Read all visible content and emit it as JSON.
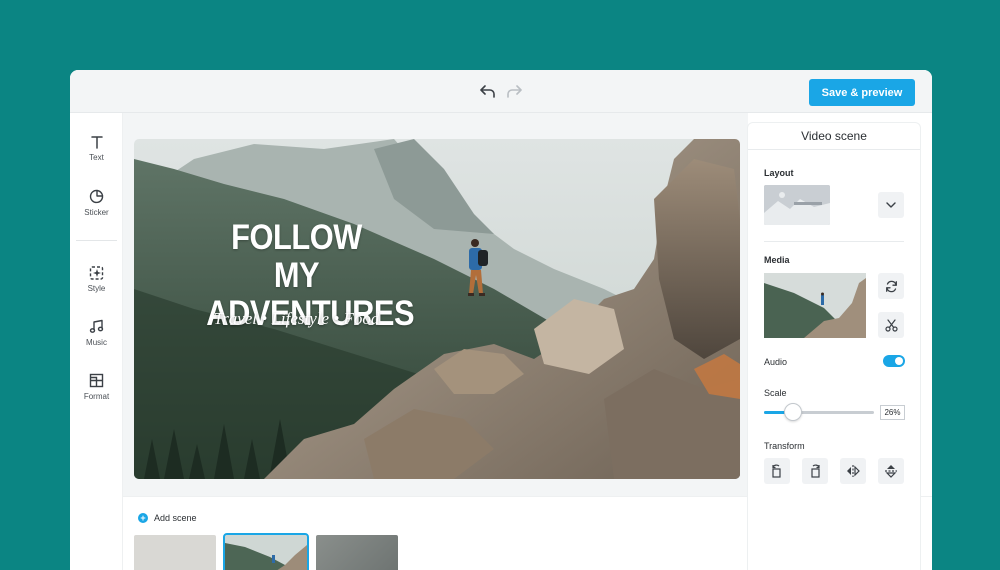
{
  "toolbar": {
    "save_label": "Save & preview"
  },
  "sidebar": {
    "items": [
      {
        "label": "Text",
        "icon": "text-icon"
      },
      {
        "label": "Sticker",
        "icon": "sticker-icon"
      },
      {
        "label": "Style",
        "icon": "style-icon"
      },
      {
        "label": "Music",
        "icon": "music-icon"
      },
      {
        "label": "Format",
        "icon": "format-icon"
      }
    ]
  },
  "scene": {
    "title_line1": "FOLLOW MY",
    "title_line2": "ADVENTURES",
    "subtitle": "Travel • Lifestyle • Food"
  },
  "panel": {
    "title": "Video scene",
    "layout_label": "Layout",
    "media_label": "Media",
    "audio_label": "Audio",
    "audio_on": true,
    "scale_label": "Scale",
    "scale_value": "26%",
    "scale_fraction": 0.26,
    "transform_label": "Transform"
  },
  "timeline": {
    "add_scene_label": "Add scene",
    "thumbnail_count": 3,
    "selected_index": 1
  },
  "colors": {
    "background": "#0b8583",
    "accent": "#1aa6e6"
  }
}
